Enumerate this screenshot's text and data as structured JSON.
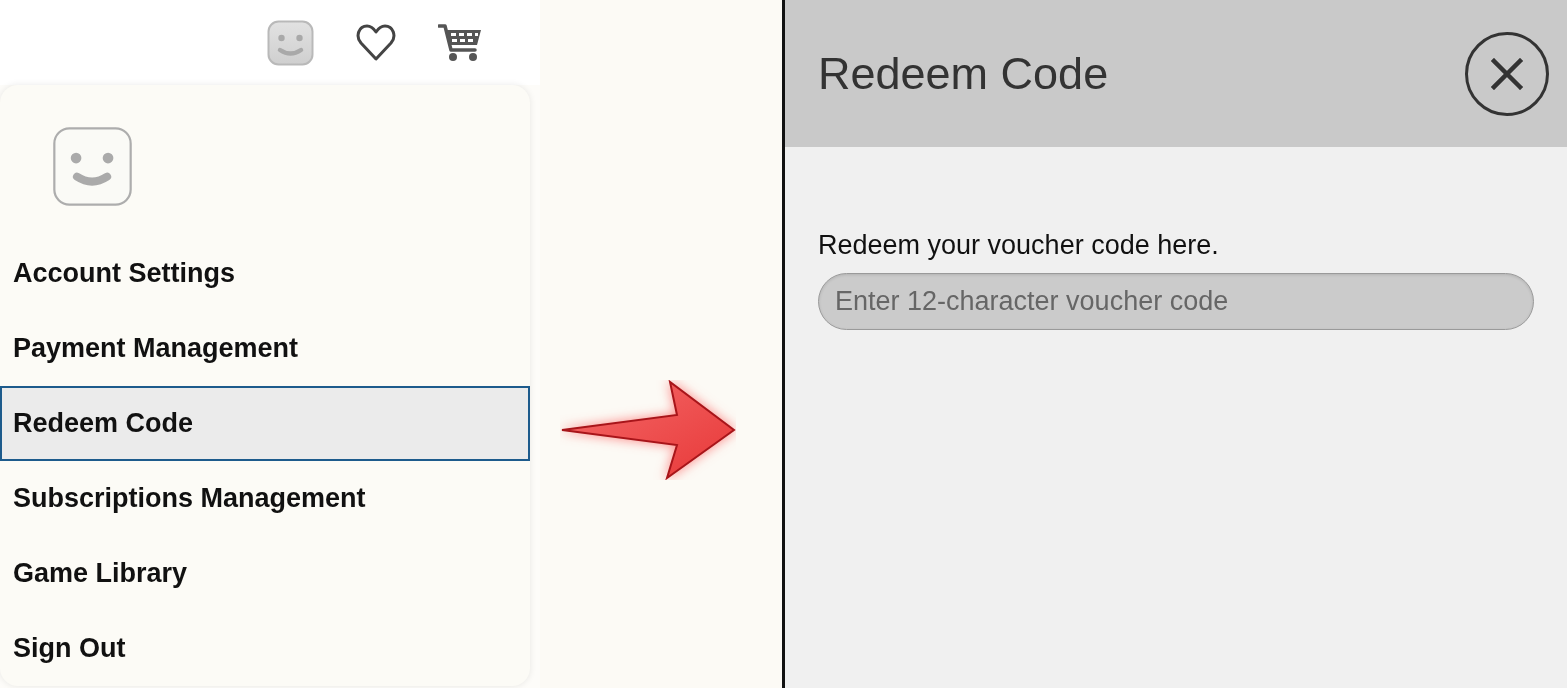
{
  "menu": {
    "items": [
      {
        "label": "Account Settings",
        "selected": false
      },
      {
        "label": "Payment Management",
        "selected": false
      },
      {
        "label": "Redeem Code",
        "selected": true
      },
      {
        "label": "Subscriptions Management",
        "selected": false
      },
      {
        "label": "Game Library",
        "selected": false
      },
      {
        "label": "Sign Out",
        "selected": false
      }
    ]
  },
  "dialog": {
    "title": "Redeem Code",
    "prompt": "Redeem your voucher code here.",
    "voucher_field": {
      "placeholder": "Enter 12-character voucher code"
    }
  }
}
